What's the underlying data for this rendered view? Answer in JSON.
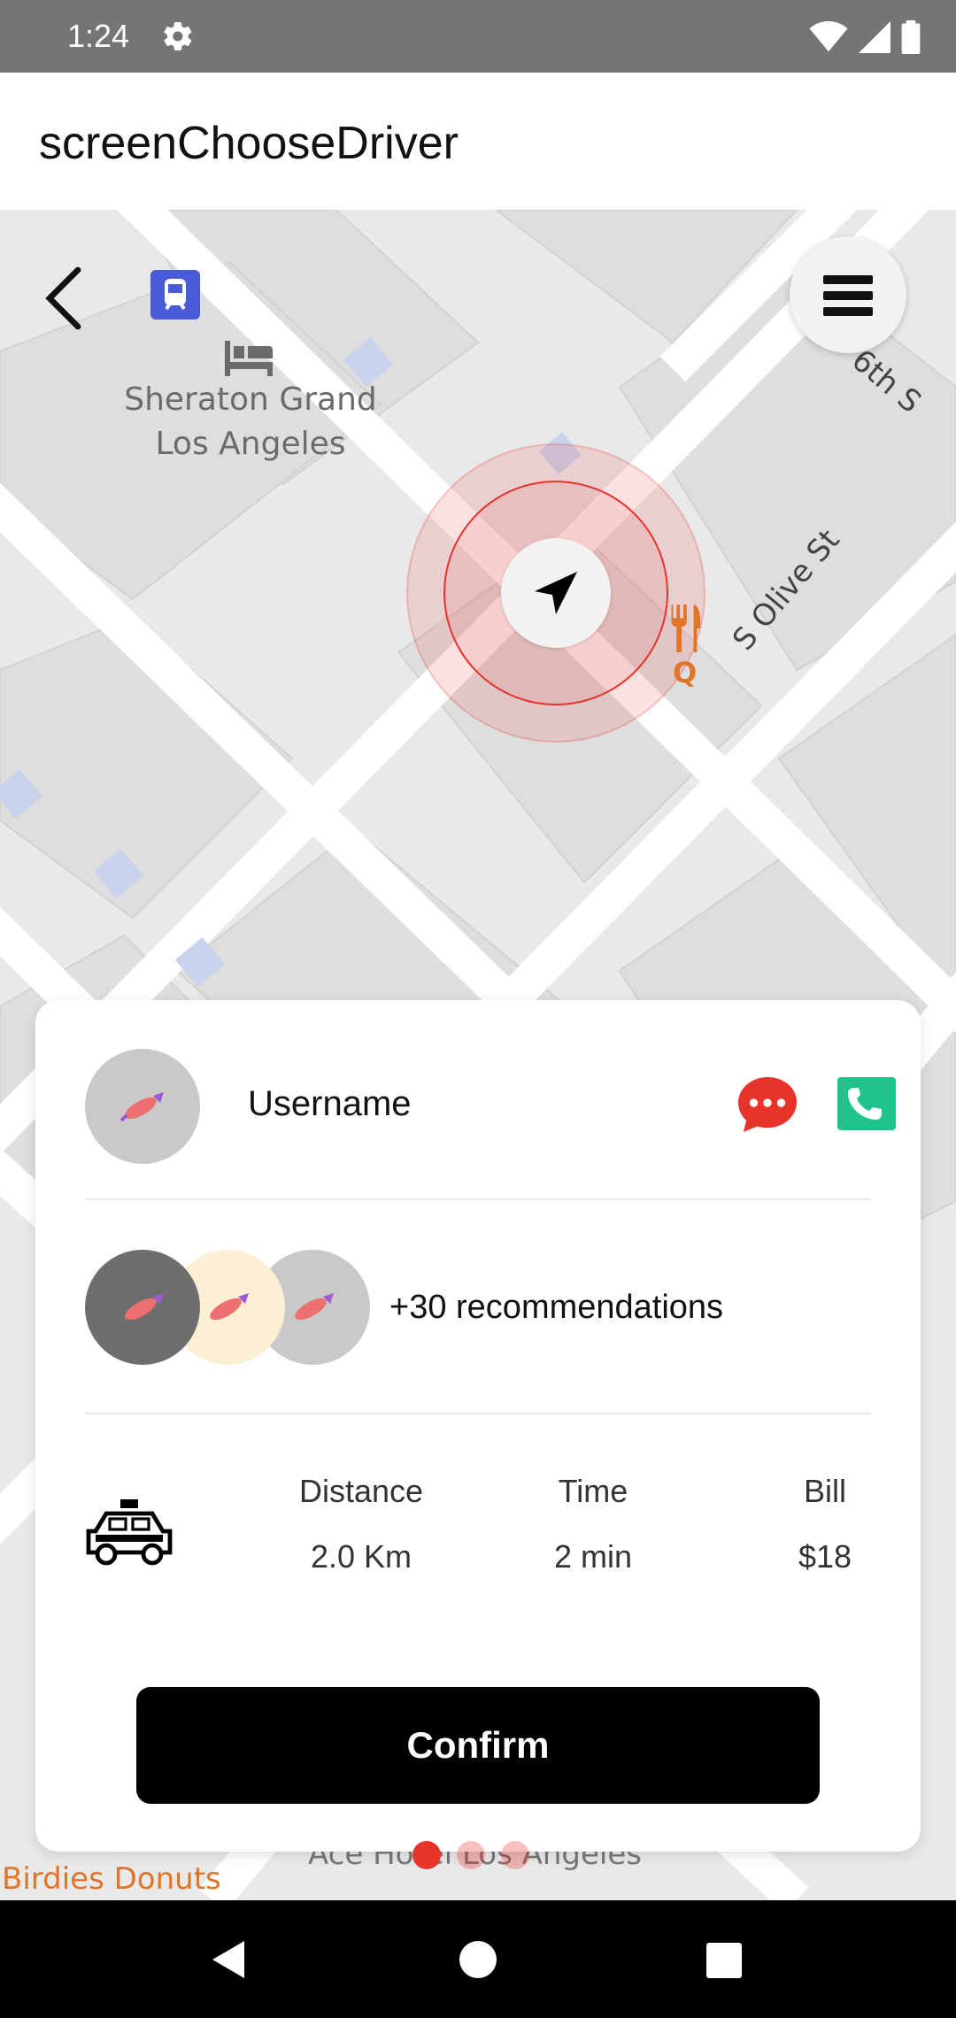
{
  "status_bar": {
    "time": "1:24",
    "icons": [
      "gear-icon",
      "wifi-icon",
      "signal-icon",
      "battery-icon"
    ]
  },
  "app_bar": {
    "title": "screenChooseDriver"
  },
  "map": {
    "labels": {
      "hotel": "Sheraton Grand\nLos Angeles",
      "street_olive": "S Olive St",
      "street_6th": "6th S",
      "restaurant": "Q",
      "bottom_left": "Birdies Donuts",
      "bottom_center": "Ace Hotel Los Angeles"
    },
    "icons": [
      "back-arrow-icon",
      "transit-icon",
      "hotel-icon",
      "navigation-arrow-icon",
      "restaurant-icon"
    ]
  },
  "driver": {
    "username": "Username"
  },
  "recommendations": {
    "text": "+30 recommendations"
  },
  "trip": {
    "distance_label": "Distance",
    "distance_value": "2.0 Km",
    "time_label": "Time",
    "time_value": "2 min",
    "bill_label": "Bill",
    "bill_value": "$18"
  },
  "actions": {
    "confirm_label": "Confirm"
  },
  "pager": {
    "count": 3,
    "active_index": 0
  },
  "colors": {
    "accent": "#e8332a",
    "phone_green": "#1fc48a",
    "confirm_bg": "#000000",
    "status_bar": "#757575"
  }
}
